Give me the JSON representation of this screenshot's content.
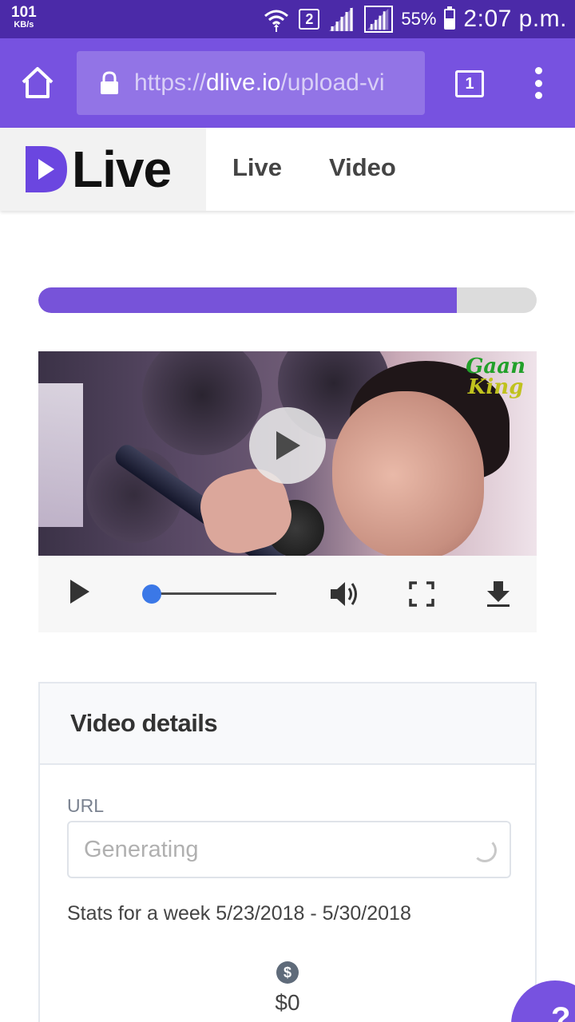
{
  "status_bar": {
    "speed_value": "101",
    "speed_unit": "KB/s",
    "sim_number": "2",
    "battery_percent": "55%",
    "battery_level": 0.55,
    "time": "2:07 p.m."
  },
  "browser": {
    "url_prefix": "https://",
    "url_domain": "dlive.io",
    "url_path": "/upload-vi",
    "tab_count": "1"
  },
  "site": {
    "logo_text": "Live",
    "nav": [
      {
        "label": "Live"
      },
      {
        "label": "Video"
      }
    ]
  },
  "upload": {
    "progress_fraction": 0.84
  },
  "video": {
    "watermark_line1": "Gaan",
    "watermark_line2": "King",
    "seek_fraction": 0.05
  },
  "details": {
    "title": "Video details",
    "url_label": "URL",
    "url_placeholder": "Generating",
    "stats_text": "Stats for a week 5/23/2018 - 5/30/2018",
    "earnings_value": "$0",
    "earnings_icon": "dollar-icon"
  },
  "colors": {
    "status_bar": "#4b2aa8",
    "browser_bar": "#7752e0",
    "accent": "#7753d9",
    "seek_accent": "#3b78e7"
  }
}
